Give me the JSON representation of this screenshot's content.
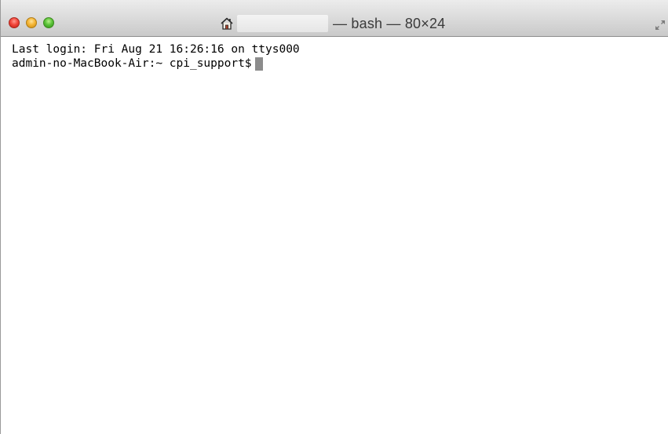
{
  "window": {
    "title": "— bash — 80×24"
  },
  "terminal": {
    "lines": [
      "Last login: Fri Aug 21 16:26:16 on ttys000",
      "admin-no-MacBook-Air:~ cpi_support$"
    ]
  },
  "icons": {
    "close": "close-button",
    "minimize": "minimize-button",
    "zoom": "zoom-button",
    "home": "home-icon",
    "fullscreen": "fullscreen-arrows-icon",
    "cursor": "block-cursor"
  },
  "colors": {
    "close": "#f2473c",
    "minimize": "#f5b637",
    "zoom": "#5cc43a",
    "cursor": "#8c8c8c",
    "background": "#ffffff",
    "text": "#000000"
  }
}
